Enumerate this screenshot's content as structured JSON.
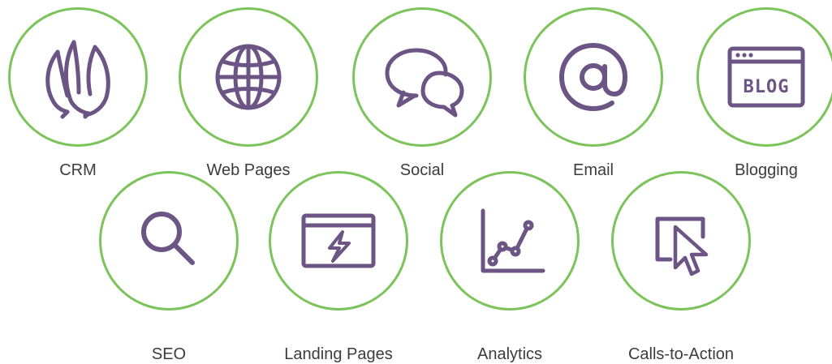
{
  "accent_color": "#6c5585",
  "ring_color": "#7cc35b",
  "features": [
    {
      "label": "CRM",
      "icon": "crm-flame-icon"
    },
    {
      "label": "Web Pages",
      "icon": "globe-icon"
    },
    {
      "label": "Social",
      "icon": "speech-bubbles-icon"
    },
    {
      "label": "Email",
      "icon": "at-sign-icon"
    },
    {
      "label": "Blogging",
      "icon": "blog-window-icon",
      "icon_text": "BLOG"
    },
    {
      "label": "SEO",
      "icon": "magnifier-icon"
    },
    {
      "label": "Landing Pages",
      "icon": "lightning-window-icon"
    },
    {
      "label": "Analytics",
      "icon": "line-graph-icon"
    },
    {
      "label": "Calls-to-Action",
      "icon": "cursor-click-icon"
    }
  ]
}
